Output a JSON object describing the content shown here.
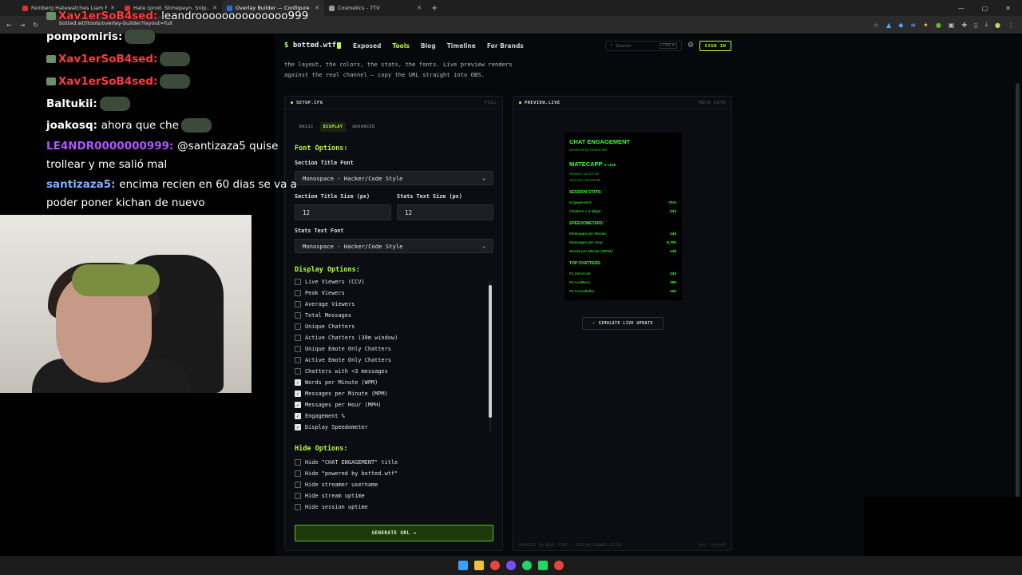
{
  "browser": {
    "tabs": [
      {
        "title": "Feinberg Hatewatches Liam Pl...",
        "color": "#e0302e"
      },
      {
        "title": "Hate (prod. Slimepayn, Snip...",
        "color": "#e0302e"
      },
      {
        "title": "Overlay Builder — Configure C...",
        "color": "#2e6be0"
      },
      {
        "title": "Cosmetics - 7TV",
        "color": "#999999"
      }
    ],
    "url": "botted.wtf/tools/overlay-builder?layout=full"
  },
  "stream_chat": [
    {
      "user": "Xav1erSoB4sed:",
      "msg": "leandroooooooooooooo999",
      "user_color": "#ff3b3b"
    },
    {
      "user": "pompomiris:",
      "msg": "",
      "user_color": "#ffffff"
    },
    {
      "user": "Xav1erSoB4sed:",
      "msg": "",
      "user_color": "#ff3b3b"
    },
    {
      "user": "Xav1erSoB4sed:",
      "msg": "",
      "user_color": "#ff3b3b"
    },
    {
      "user": "Baltukii:",
      "msg": "",
      "user_color": "#ffffff"
    },
    {
      "user": "joakosq:",
      "msg": "ahora que che",
      "user_color": "#ffffff"
    },
    {
      "user": "LE4NDR0000000999:",
      "msg": "@santizaza5 quise",
      "user_color": "#b155ff"
    },
    {
      "user": "",
      "msg": "trollear y me salió mal",
      "user_color": "#ffffff"
    },
    {
      "user": "santizaza5:",
      "msg": "encima recien en 60 dias se va a",
      "user_color": "#7fb0ff"
    },
    {
      "user": "",
      "msg": "poder poner kichan de nuevo",
      "user_color": "#ffffff"
    }
  ],
  "site": {
    "brand": "botted.wtf",
    "nav": [
      "Exposed",
      "Tools",
      "Blog",
      "Timeline",
      "For Brands"
    ],
    "search_placeholder": "Search",
    "search_kbd": "CTRL K",
    "signin": "SIGN IN",
    "intro_line1": "the layout, the colors, the stats, the fonts. Live preview renders",
    "intro_line2": "against the real channel — copy the URL straight into OBS."
  },
  "setup": {
    "head": "SETUP.CFG",
    "head_right": "FULL",
    "tabs": [
      "BASIC",
      "DISPLAY",
      "ADVANCED"
    ],
    "font_options": "Font Options:",
    "section_title_font_label": "Section Title Font",
    "section_title_font_value": "Monospace - Hacker/Code Style",
    "section_title_size_label": "Section Title Size (px)",
    "section_title_size_value": "12",
    "stats_text_size_label": "Stats Text Size (px)",
    "stats_text_size_value": "12",
    "stats_text_font_label": "Stats Text Font",
    "stats_text_font_value": "Monospace - Hacker/Code Style",
    "display_options": "Display Options:",
    "display_items": [
      {
        "label": "Live Viewers (CCV)",
        "checked": false
      },
      {
        "label": "Peak Viewers",
        "checked": false
      },
      {
        "label": "Average Viewers",
        "checked": false
      },
      {
        "label": "Total Messages",
        "checked": false
      },
      {
        "label": "Unique Chatters",
        "checked": false
      },
      {
        "label": "Active Chatters (30m window)",
        "checked": false
      },
      {
        "label": "Unique Emote Only Chatters",
        "checked": false
      },
      {
        "label": "Active Emote Only Chatters",
        "checked": false
      },
      {
        "label": "Chatters with <3 messages",
        "checked": false
      },
      {
        "label": "Words per Minute (WPM)",
        "checked": true
      },
      {
        "label": "Messages per Minute (MPM)",
        "checked": true
      },
      {
        "label": "Messages per Hour (MPH)",
        "checked": true
      },
      {
        "label": "Engagement %",
        "checked": true
      },
      {
        "label": "Display Speedometer",
        "checked": true
      }
    ],
    "hide_options": "Hide Options:",
    "hide_items": [
      "Hide \"CHAT ENGAGEMENT\" title",
      "Hide \"powered by botted.wtf\"",
      "Hide streamer username",
      "Hide stream uptime",
      "Hide session uptime"
    ],
    "generate": "GENERATE URL ⟶"
  },
  "preview": {
    "head": "PREVIEW.LIVE",
    "head_right": "MOCK DATA",
    "title": "CHAT ENGAGEMENT",
    "powered": "powered by botted.wtf",
    "username": "MATECAPP",
    "live": "● LIVE",
    "stream_time": "Stream: 02:07:18",
    "session_time": "Session: 00:00:08",
    "session_stats": "SESSION STATS:",
    "engagement_label": "Engagement:",
    "engagement_value": "75%",
    "chatters_label": "Chatters < 3 Msgs:",
    "chatters_value": "234",
    "speedometers": "SPEEDOMETERS:",
    "mpm_label": "Messages per Minute:",
    "mpm_value": "145",
    "mph_label": "Messages per Hour:",
    "mph_value": "8,700",
    "wpm_label": "Words per Minute (WPM):",
    "wpm_value": "145",
    "top_chatters": "TOP CHATTERS:",
    "top": [
      {
        "name": "#1 ZeroCool",
        "value": "234"
      },
      {
        "name": "#2 AcidBurn",
        "value": "189"
      },
      {
        "name": "#3 CerealKiller",
        "value": "156"
      }
    ],
    "simulate": "SIMULATE LIVE UPDATE",
    "foot_left": "UPDATES IN REAL-TIME · STREAM-CORNER SIZED",
    "foot_right": "FULL LAYOUT"
  }
}
